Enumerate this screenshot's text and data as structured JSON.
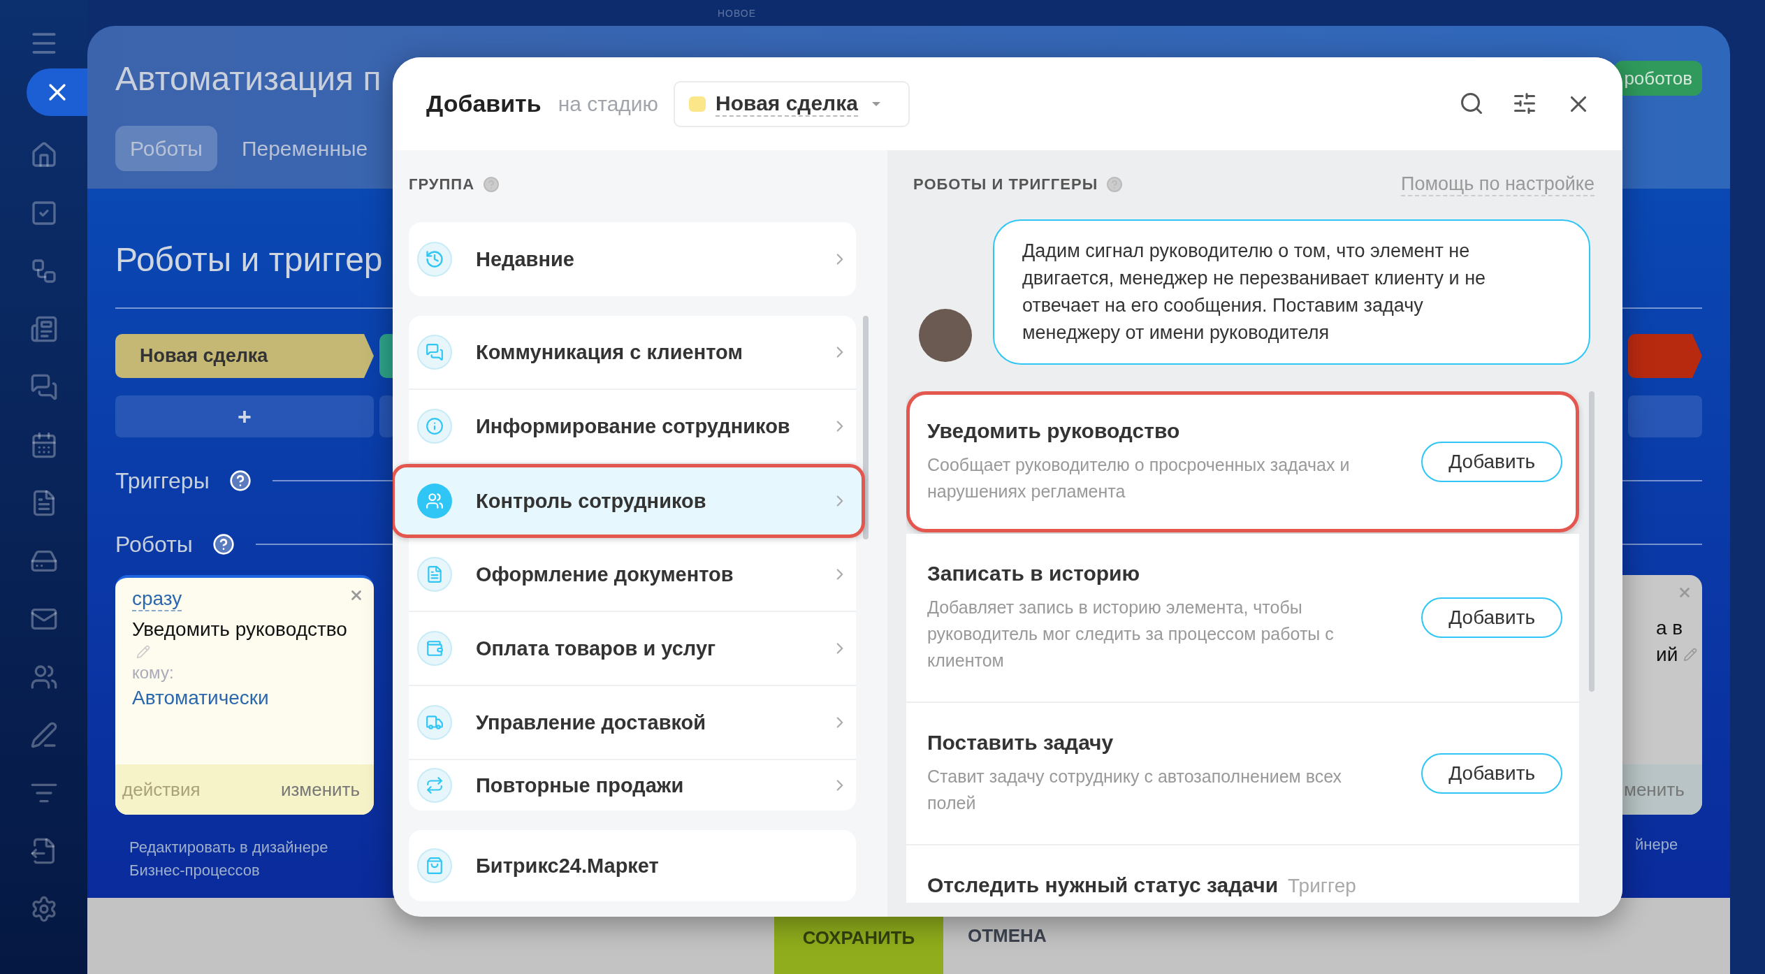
{
  "top_badge": "НОВОЕ",
  "page": {
    "title": "Автоматизация п",
    "header_button": "роботов",
    "tabs": [
      {
        "label": "Роботы",
        "selected": true
      },
      {
        "label": "Переменные",
        "selected": false
      }
    ],
    "heading": "Роботы и триггер",
    "stages": [
      {
        "label": "Новая сделка",
        "color": "#c4b874",
        "add": "+"
      },
      {
        "color": "#2ea58a"
      },
      {
        "color": "#b82a10"
      }
    ],
    "triggers_title": "Триггеры",
    "robots_title": "Роботы",
    "robot_card": {
      "timing": "сразу",
      "title": "Уведомить руководство",
      "to_label": "кому:",
      "to_value": "Автоматически",
      "actions": {
        "label": "действия",
        "disabled": true
      },
      "edit": "изменить"
    },
    "robot_card_edge": {
      "lines": [
        "а в",
        "ий"
      ],
      "edit": "менить"
    },
    "designer_link": "Редактировать в дизайнере Бизнес-процессов",
    "designer_link_edge": "йнере"
  },
  "footer": {
    "save": "СОХРАНИТЬ",
    "cancel": "ОТМЕНА"
  },
  "modal": {
    "title": "Добавить",
    "stage_label": "на стадию",
    "stage": "Новая сделка",
    "groups_title": "ГРУППА",
    "recent": "Недавние",
    "groups": [
      {
        "label": "Коммуникация с клиентом",
        "selected": false,
        "highlighted": false
      },
      {
        "label": "Информирование сотрудников",
        "selected": false,
        "highlighted": false
      },
      {
        "label": "Контроль сотрудников",
        "selected": true,
        "highlighted": true
      },
      {
        "label": "Оформление документов",
        "selected": false,
        "highlighted": false
      },
      {
        "label": "Оплата товаров и услуг",
        "selected": false,
        "highlighted": false
      },
      {
        "label": "Управление доставкой",
        "selected": false,
        "highlighted": false
      },
      {
        "label": "Повторные продажи",
        "selected": false,
        "highlighted": false
      }
    ],
    "market": "Битрикс24.Маркет",
    "robots_title": "РОБОТЫ И ТРИГГЕРЫ",
    "help_link": "Помощь по настройке",
    "hint": "Дадим сигнал руководителю о том, что элемент не двигается, менеджер не перезванивает клиенту и не отвечает на его сообщения. Поставим задачу менеджеру от имени руководителя",
    "robots": [
      {
        "title": "Уведомить руководство",
        "description": "Сообщает руководителю о просроченных задачах и нарушениях регламента",
        "button": "Добавить",
        "highlighted": true
      },
      {
        "title": "Записать в историю",
        "description": "Добавляет запись в историю элемента, чтобы руководитель мог следить за процессом работы с клиентом",
        "button": "Добавить",
        "highlighted": false
      },
      {
        "title": "Поставить задачу",
        "description": "Ставит задачу сотруднику с автозаполнением всех полей",
        "button": "Добавить",
        "highlighted": false
      },
      {
        "title": "Отследить нужный статус задачи",
        "tag": "Триггер",
        "highlighted": false
      }
    ]
  }
}
